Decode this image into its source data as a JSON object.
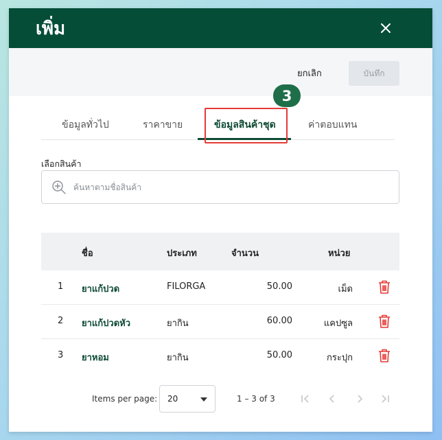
{
  "dialog": {
    "title": "เพิ่ม",
    "close_icon": "close-icon"
  },
  "toolbar": {
    "cancel_label": "ยกเลิก",
    "save_label": "บันทึก"
  },
  "step_badge": "3",
  "tabs": [
    {
      "label": "ข้อมูลทั่วไป",
      "active": false
    },
    {
      "label": "ราคาขาย",
      "active": false
    },
    {
      "label": "ข้อมูลสินค้าชุด",
      "active": true
    },
    {
      "label": "ค่าตอบแทน",
      "active": false
    }
  ],
  "product_search": {
    "label": "เลือกสินค้า",
    "value": "",
    "placeholder": "ค้นหาตามชื่อสินค้า",
    "icon": "zoom-in-icon"
  },
  "table": {
    "headers": {
      "name": "ชื่อ",
      "type": "ประเภท",
      "quantity": "จำนวน",
      "unit": "หน่วย"
    },
    "rows": [
      {
        "index": "1",
        "name": "ยาแก้ปวด",
        "type": "FILORGA",
        "quantity": "50.00",
        "unit": "เม็ด"
      },
      {
        "index": "2",
        "name": "ยาแก้ปวดหัว",
        "type": "ยากิน",
        "quantity": "60.00",
        "unit": "แคปซูล"
      },
      {
        "index": "3",
        "name": "ยาหอม",
        "type": "ยากิน",
        "quantity": "50.00",
        "unit": "กระปุก"
      }
    ],
    "delete_icon": "trash-icon"
  },
  "paginator": {
    "items_per_page_label": "Items per page:",
    "page_size": "20",
    "range_label": "1 – 3 of 3"
  },
  "colors": {
    "brand": "#064d38",
    "delete": "#e53935",
    "highlight": "#e53935"
  }
}
